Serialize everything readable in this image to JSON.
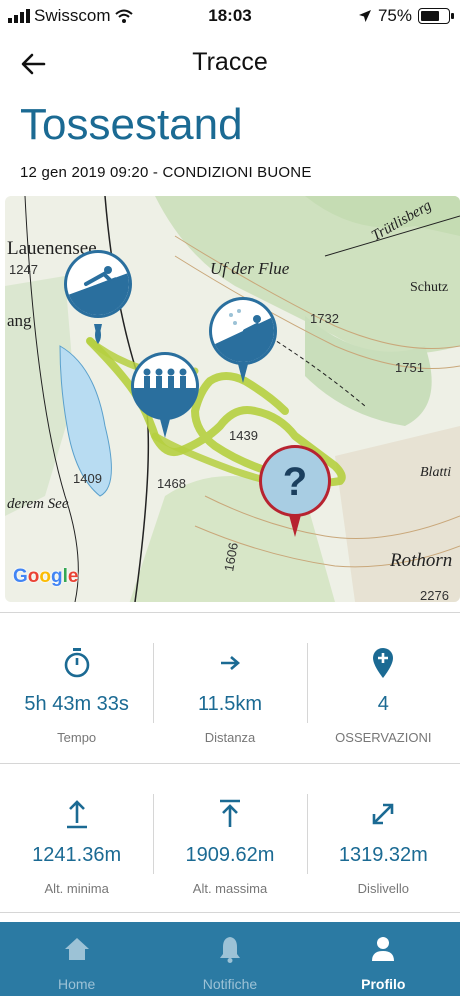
{
  "status_bar": {
    "carrier": "Swisscom",
    "time": "18:03",
    "battery": "75%",
    "battery_level": 0.75
  },
  "nav": {
    "title": "Tracce"
  },
  "track": {
    "name": "Tossestand",
    "date": "12 gen 2019 09:20",
    "condition": "CONDIZIONI BUONE"
  },
  "map": {
    "attribution": "Google",
    "place_names": [
      "Lauenensee",
      "Uf der Flue",
      "Trütlisberg",
      "Schutz",
      "Rothorn",
      "derem See",
      "Blatti",
      "ang"
    ],
    "elevations": [
      "1247",
      "1732",
      "1751",
      "1439",
      "1409",
      "1468",
      "1606",
      "2276"
    ],
    "markers": [
      {
        "icon": "skier-downhill-icon"
      },
      {
        "icon": "group-hikers-icon"
      },
      {
        "icon": "skier-snow-icon"
      },
      {
        "icon": "question-icon",
        "label": "?"
      }
    ]
  },
  "stats": [
    {
      "value": "5h 43m 33s",
      "label": "Tempo",
      "icon": "stopwatch-icon"
    },
    {
      "value": "11.5km",
      "label": "Distanza",
      "icon": "arrow-right-icon"
    },
    {
      "value": "4",
      "label": "OSSERVAZIONI",
      "icon": "pin-plus-icon"
    },
    {
      "value": "1241.36m",
      "label": "Alt. minima",
      "icon": "arrow-up-from-line-icon"
    },
    {
      "value": "1909.62m",
      "label": "Alt. massima",
      "icon": "arrow-up-to-line-icon"
    },
    {
      "value": "1319.32m",
      "label": "Dislivello",
      "icon": "diagonal-expand-icon"
    }
  ],
  "tabs": [
    {
      "label": "Home",
      "icon": "home-icon"
    },
    {
      "label": "Notifiche",
      "icon": "bell-icon"
    },
    {
      "label": "Profilo",
      "icon": "person-icon",
      "active": true
    }
  ],
  "colors": {
    "accent": "#1b6a93",
    "tabbar": "#2b7aa3",
    "track": "#b5cf3f",
    "marker_blue": "#2a6f9e",
    "marker_red": "#b72330"
  }
}
